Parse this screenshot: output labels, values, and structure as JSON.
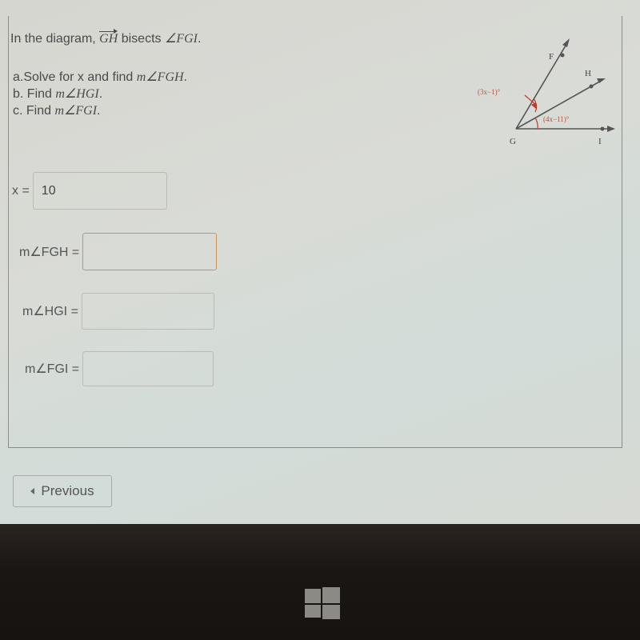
{
  "question": {
    "prefix": "In the diagram, ",
    "ray": "GH",
    "middle": " bisects ",
    "angle": "∠FGI",
    "suffix": "."
  },
  "parts": [
    {
      "text": "a.Solve for x and find ",
      "math": "m∠FGH",
      "end": "."
    },
    {
      "text": "b. Find ",
      "math": "m∠HGI",
      "end": "."
    },
    {
      "text": "c. Find ",
      "math": "m∠FGI",
      "end": "."
    }
  ],
  "diagram": {
    "points": {
      "F": "F",
      "H": "H",
      "G": "G",
      "I": "I"
    },
    "angle_label_top": "(3x−1)°",
    "angle_label_bottom": "(4x−11)°",
    "mark_color": "#c0392b",
    "label_color": "#b5533f"
  },
  "answers": {
    "x": {
      "label": "x =",
      "value": "10"
    },
    "fgh": {
      "label": "m∠FGH =",
      "value": ""
    },
    "hgi": {
      "label": "m∠HGI =",
      "value": ""
    },
    "fgi": {
      "label": "m∠FGI =",
      "value": ""
    }
  },
  "nav": {
    "previous_label": "Previous"
  },
  "taskbar": {
    "logo": "windows-logo"
  }
}
